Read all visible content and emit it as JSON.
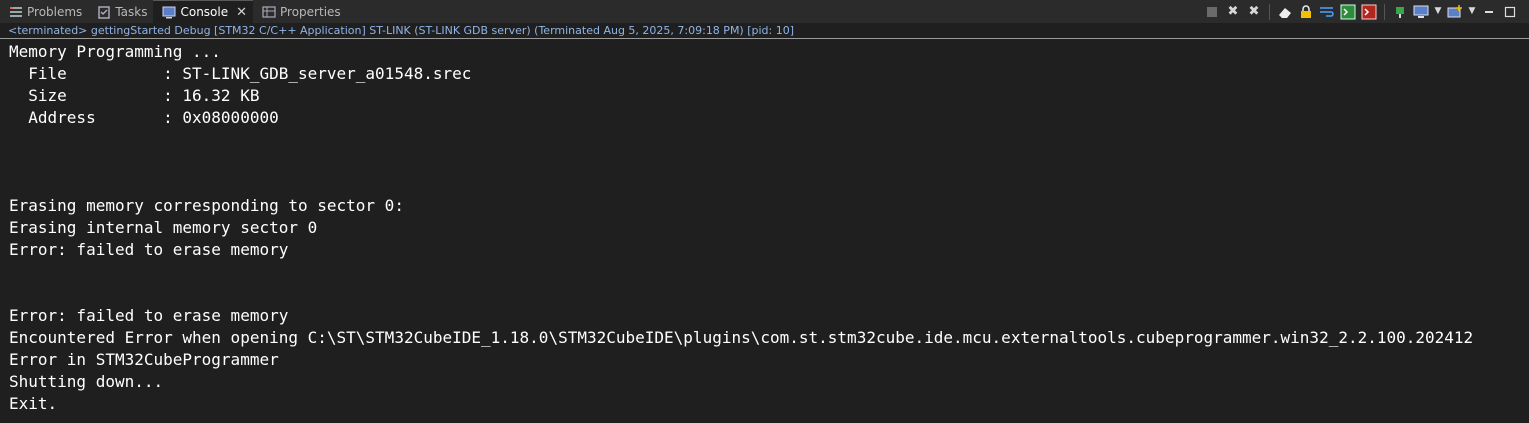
{
  "tabs": [
    {
      "label": "Problems",
      "icon": "problems-icon",
      "active": false
    },
    {
      "label": "Tasks",
      "icon": "tasks-icon",
      "active": false
    },
    {
      "label": "Console",
      "icon": "console-icon",
      "active": true
    },
    {
      "label": "Properties",
      "icon": "properties-icon",
      "active": false
    }
  ],
  "status_text": "<terminated> gettingStarted Debug [STM32 C/C++ Application] ST-LINK (ST-LINK GDB server) (Terminated Aug 5, 2025, 7:09:18 PM) [pid: 10]",
  "console_lines": [
    "Memory Programming ...",
    "  File          : ST-LINK_GDB_server_a01548.srec",
    "  Size          : 16.32 KB",
    "  Address       : 0x08000000",
    "",
    "",
    "",
    "Erasing memory corresponding to sector 0:",
    "Erasing internal memory sector 0",
    "Error: failed to erase memory",
    "",
    "",
    "Error: failed to erase memory",
    "Encountered Error when opening C:\\ST\\STM32CubeIDE_1.18.0\\STM32CubeIDE\\plugins\\com.st.stm32cube.ide.mcu.externaltools.cubeprogrammer.win32_2.2.100.202412",
    "Error in STM32CubeProgrammer",
    "Shutting down...",
    "Exit."
  ],
  "colors": {
    "status_link": "#8fb4e8",
    "console_text": "#ffffff",
    "background": "#1f1f1f"
  }
}
